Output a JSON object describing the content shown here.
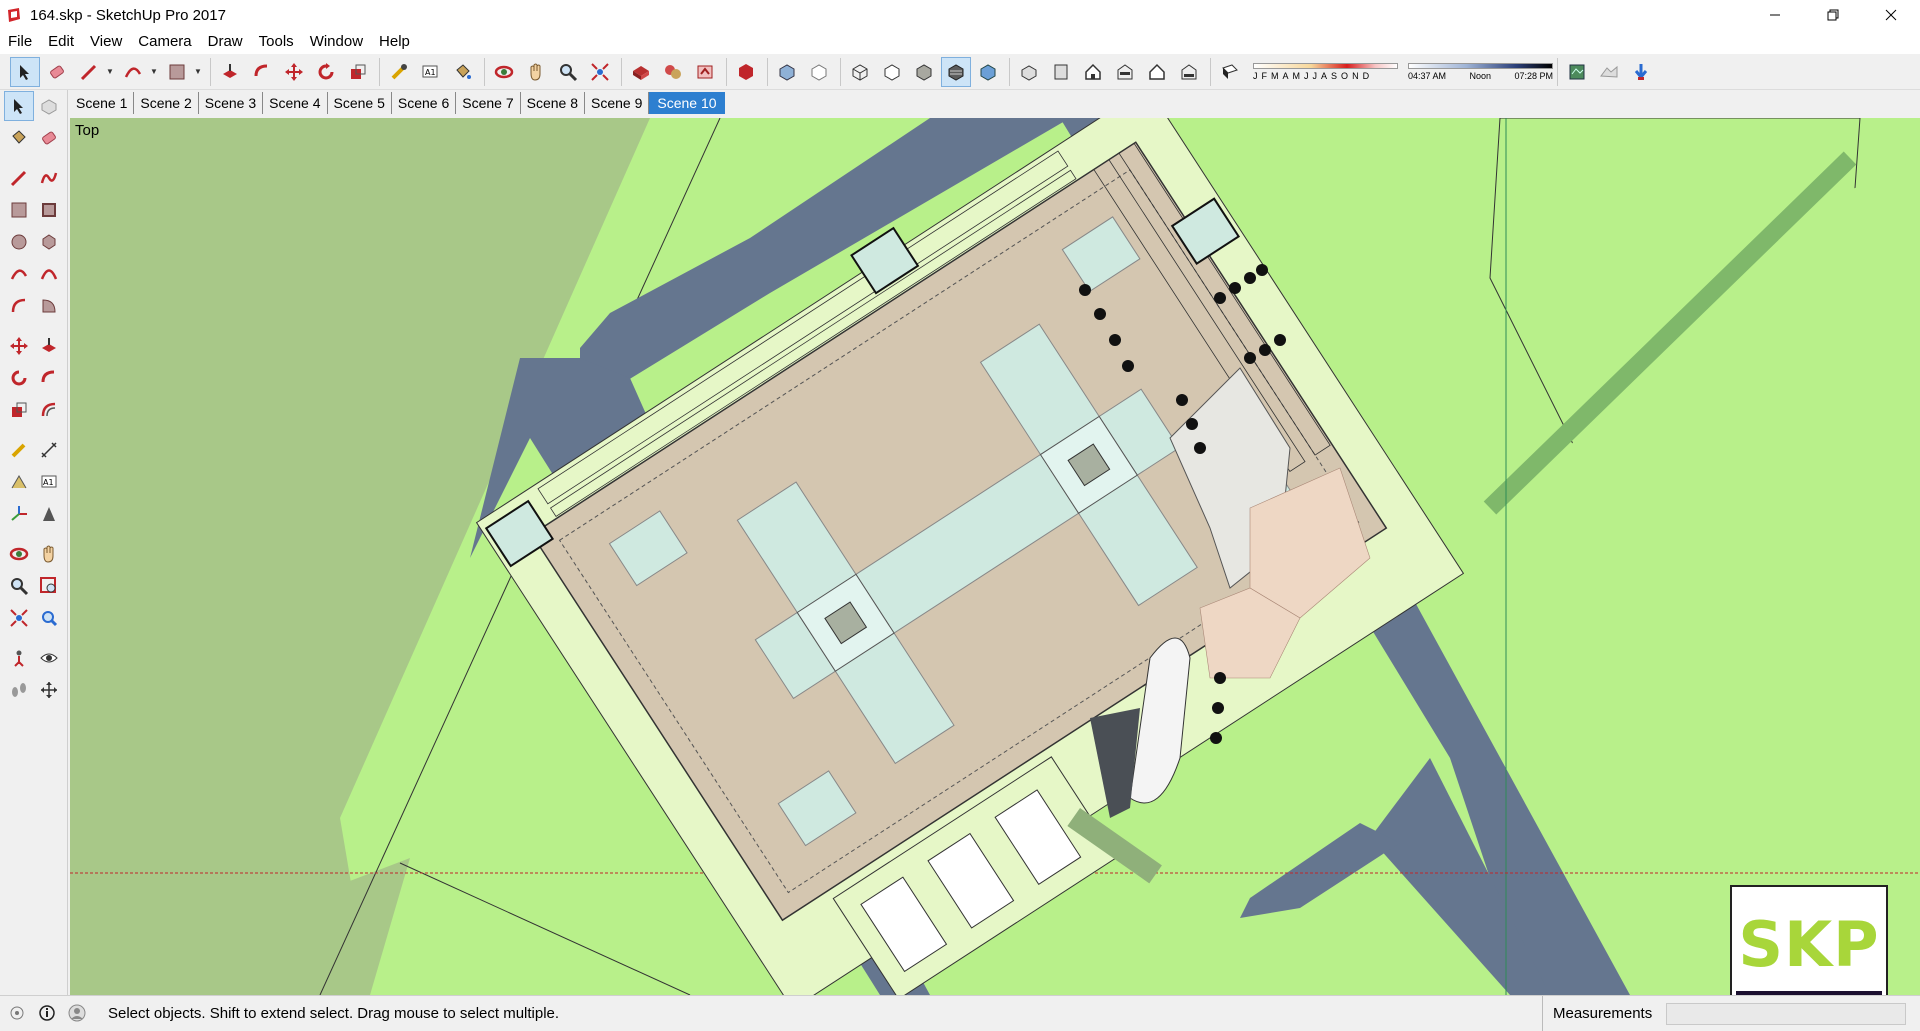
{
  "window": {
    "title": "164.skp - SketchUp Pro 2017"
  },
  "menu": {
    "items": [
      "File",
      "Edit",
      "View",
      "Camera",
      "Draw",
      "Tools",
      "Window",
      "Help"
    ]
  },
  "shadow": {
    "months": [
      "J",
      "F",
      "M",
      "A",
      "M",
      "J",
      "J",
      "A",
      "S",
      "O",
      "N",
      "D"
    ],
    "time_start": "04:37 AM",
    "time_mid": "Noon",
    "time_end": "07:28 PM"
  },
  "scenes": {
    "tabs": [
      "Scene 1",
      "Scene 2",
      "Scene 3",
      "Scene 4",
      "Scene 5",
      "Scene 6",
      "Scene 7",
      "Scene 8",
      "Scene 9",
      "Scene 10"
    ],
    "active": "Scene 10"
  },
  "viewport": {
    "view_label": "Top",
    "watermark": "SKP"
  },
  "status": {
    "message": "Select objects. Shift to extend select. Drag mouse to select multiple.",
    "measurements_label": "Measurements",
    "measurements_value": ""
  },
  "colors": {
    "grass_dark": "#a8c888",
    "grass_light": "#b8f08a",
    "road": "#65768f",
    "paving": "#d4c6b0",
    "glass": "#cfe9e0",
    "accent_blue": "#2d7fd0"
  }
}
